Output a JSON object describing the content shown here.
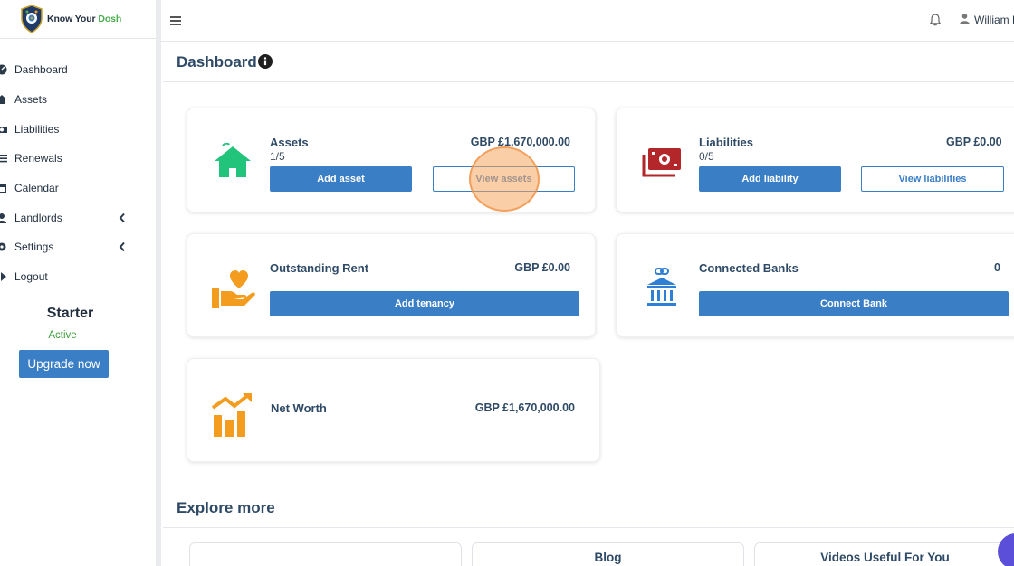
{
  "brand": {
    "name_part1": "Know Your ",
    "name_part2": "Dosh"
  },
  "sidebar": {
    "items": [
      {
        "label": "Dashboard",
        "icon": "dashboard-icon"
      },
      {
        "label": "Assets",
        "icon": "assets-icon"
      },
      {
        "label": "Liabilities",
        "icon": "liabilities-icon"
      },
      {
        "label": "Renewals",
        "icon": "renewals-icon"
      },
      {
        "label": "Calendar",
        "icon": "calendar-icon"
      },
      {
        "label": "Landlords",
        "icon": "landlords-icon",
        "expandable": true
      },
      {
        "label": "Settings",
        "icon": "settings-icon",
        "expandable": true
      },
      {
        "label": "Logout",
        "icon": "logout-icon"
      }
    ],
    "plan": {
      "name": "Starter",
      "status": "Active",
      "upgrade_label": "Upgrade now"
    }
  },
  "topbar": {
    "user_name": "William H"
  },
  "page": {
    "title": "Dashboard"
  },
  "cards": {
    "assets": {
      "title": "Assets",
      "amount": "GBP £1,670,000.00",
      "count": "1/5",
      "primary_label": "Add asset",
      "secondary_label": "View assets"
    },
    "liabilities": {
      "title": "Liabilities",
      "amount": "GBP £0.00",
      "count": "0/5",
      "primary_label": "Add liability",
      "secondary_label": "View liabilities"
    },
    "rent": {
      "title": "Outstanding Rent",
      "amount": "GBP £0.00",
      "primary_label": "Add tenancy"
    },
    "banks": {
      "title": "Connected Banks",
      "amount": "0",
      "primary_label": "Connect Bank"
    },
    "networth": {
      "title": "Net Worth",
      "amount": "GBP £1,670,000.00"
    }
  },
  "explore": {
    "title": "Explore more",
    "cards": [
      {
        "title": ""
      },
      {
        "title": "Blog"
      },
      {
        "title": "Videos Useful For You"
      }
    ]
  },
  "colors": {
    "primary": "#3a7ec6",
    "heading": "#2f4a66",
    "assets_icon": "#22c37a",
    "liabilities_icon": "#b3262a",
    "rent_icon": "#f39c1e",
    "banks_icon": "#2f7fd4",
    "networth_icon": "#f39c1e",
    "status_active": "#3aa03a"
  }
}
